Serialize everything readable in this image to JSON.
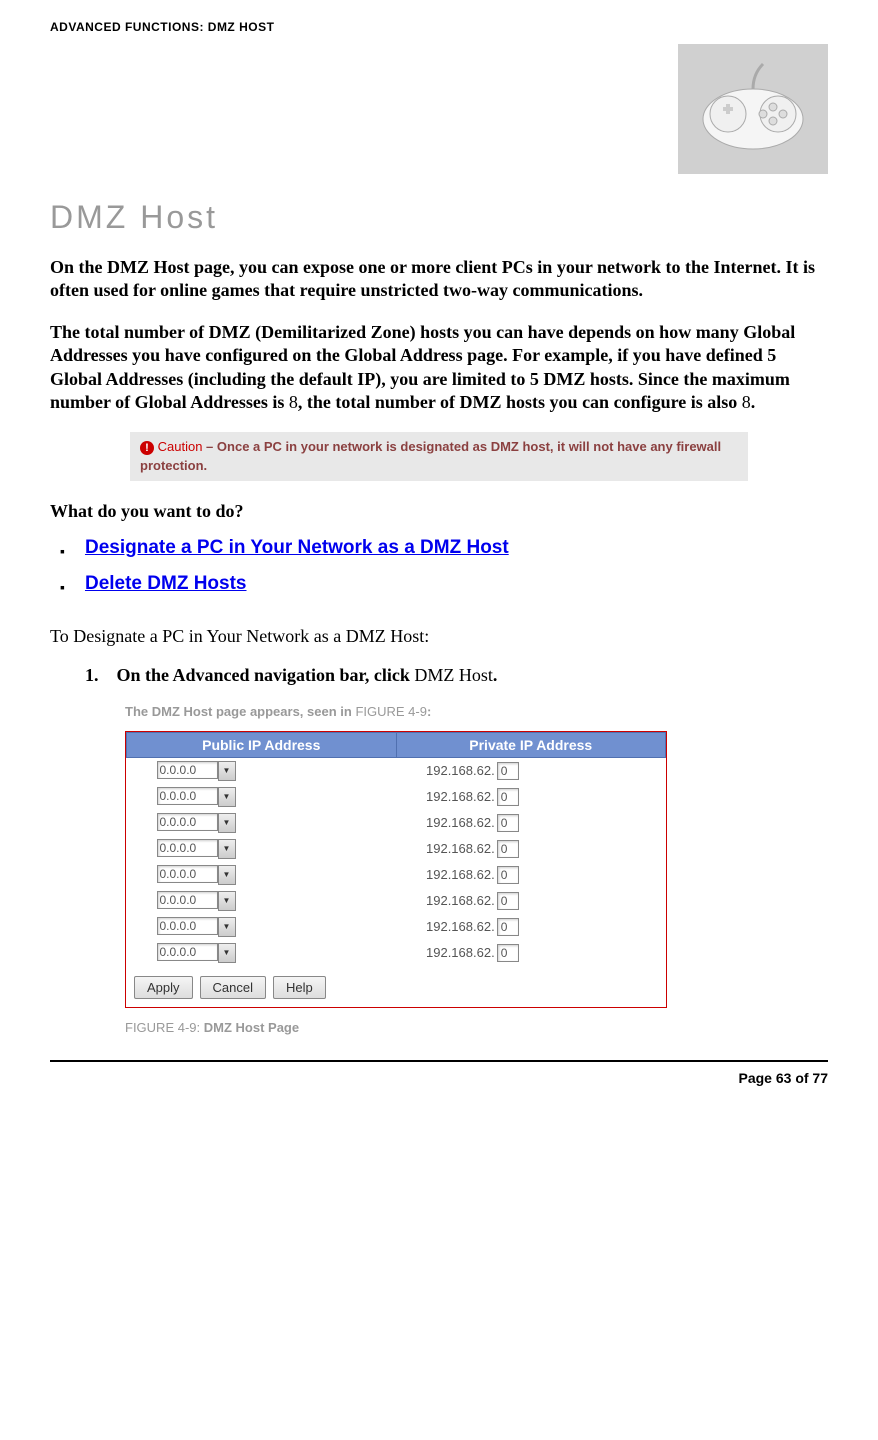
{
  "header": "ADVANCED FUNCTIONS: DMZ HOST",
  "title": "DMZ Host",
  "para1": "On the DMZ Host page, you can expose one or more client PCs in your network to the Internet. It is often used for online games that require unstricted two-way communications.",
  "para2_a": "The total number of DMZ (Demilitarized Zone) hosts you can have depends on how many Global Addresses you have configured on the Global Address page. For example, if you have defined 5 Global Addresses (including the default IP), you are limited to 5 DMZ hosts. Since the maximum number of Global Addresses is ",
  "para2_num1": "8",
  "para2_b": ", the total number of DMZ hosts you can configure is also ",
  "para2_num2": "8",
  "para2_c": ".",
  "caution": {
    "symbol": "!",
    "label": "Caution",
    "dash": " – ",
    "text": "Once a PC in your network is designated as DMZ host, it will not have any firewall protection."
  },
  "question": "What do you want to do?",
  "links": [
    "Designate a PC in Your Network as a DMZ Host",
    "Delete DMZ Hosts"
  ],
  "subhead": "To Designate a PC in Your Network as a DMZ Host:",
  "step1": {
    "num": "1.",
    "text_a": "On the Advanced navigation bar, click ",
    "text_b": "DMZ Host",
    "text_c": "."
  },
  "subnote": {
    "text": "The DMZ Host page appears, seen in ",
    "ref": "FIGURE 4-9",
    "colon": ":"
  },
  "table": {
    "col1": "Public IP Address",
    "col2": "Private IP Address",
    "rows": [
      {
        "public": "0.0.0.0",
        "private_prefix": "192.168.62.",
        "private_last": "0"
      },
      {
        "public": "0.0.0.0",
        "private_prefix": "192.168.62.",
        "private_last": "0"
      },
      {
        "public": "0.0.0.0",
        "private_prefix": "192.168.62.",
        "private_last": "0"
      },
      {
        "public": "0.0.0.0",
        "private_prefix": "192.168.62.",
        "private_last": "0"
      },
      {
        "public": "0.0.0.0",
        "private_prefix": "192.168.62.",
        "private_last": "0"
      },
      {
        "public": "0.0.0.0",
        "private_prefix": "192.168.62.",
        "private_last": "0"
      },
      {
        "public": "0.0.0.0",
        "private_prefix": "192.168.62.",
        "private_last": "0"
      },
      {
        "public": "0.0.0.0",
        "private_prefix": "192.168.62.",
        "private_last": "0"
      }
    ],
    "buttons": {
      "apply": "Apply",
      "cancel": "Cancel",
      "help": "Help"
    }
  },
  "figure_caption": {
    "label": "FIGURE 4-9: ",
    "title": "DMZ Host Page"
  },
  "footer": "Page 63 of 77"
}
